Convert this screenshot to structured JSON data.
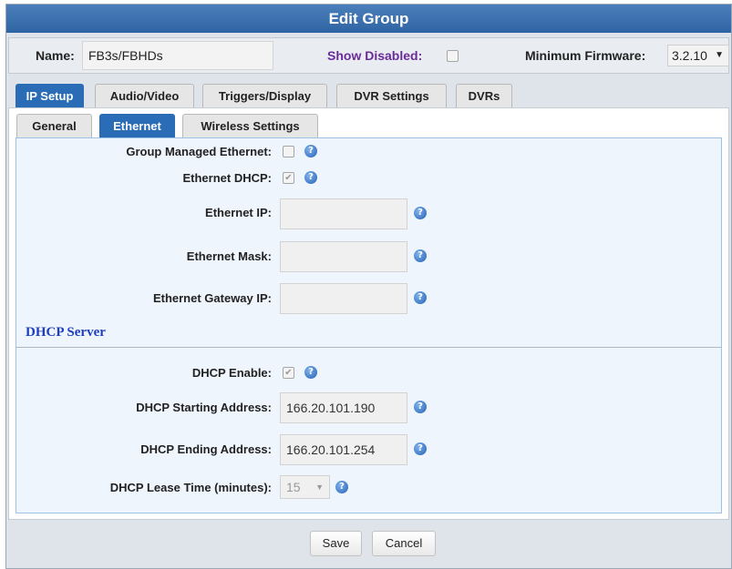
{
  "window": {
    "title": "Edit Group"
  },
  "topbar": {
    "name_label": "Name:",
    "name_value": "FB3s/FBHDs",
    "show_disabled_label": "Show Disabled:",
    "show_disabled_checked": false,
    "firmware_label": "Minimum Firmware:",
    "firmware_value": "3.2.10",
    "firmware_arrow": "▼"
  },
  "main_tabs": [
    {
      "label": "IP Setup",
      "active": true
    },
    {
      "label": "Audio/Video",
      "active": false
    },
    {
      "label": "Triggers/Display",
      "active": false
    },
    {
      "label": "DVR Settings",
      "active": false
    },
    {
      "label": "DVRs",
      "active": false
    }
  ],
  "sub_tabs": [
    {
      "label": "General",
      "active": false
    },
    {
      "label": "Ethernet",
      "active": true
    },
    {
      "label": "Wireless Settings",
      "active": false
    }
  ],
  "ethernet": {
    "group_managed_label": "Group Managed Ethernet:",
    "group_managed_checked": false,
    "dhcp_label": "Ethernet DHCP:",
    "dhcp_checked": true,
    "ip_label": "Ethernet IP:",
    "ip_value": "",
    "mask_label": "Ethernet Mask:",
    "mask_value": "",
    "gateway_label": "Ethernet Gateway IP:",
    "gateway_value": ""
  },
  "dhcp_server": {
    "section_title": "DHCP Server",
    "enable_label": "DHCP Enable:",
    "enable_checked": true,
    "start_label": "DHCP Starting Address:",
    "start_value": "166.20.101.190",
    "end_label": "DHCP Ending Address:",
    "end_value": "166.20.101.254",
    "lease_label": "DHCP Lease Time (minutes):",
    "lease_value": "15",
    "lease_arrow": "▼"
  },
  "icons": {
    "help": "?",
    "check": "✔"
  },
  "buttons": {
    "save": "Save",
    "cancel": "Cancel"
  },
  "colors": {
    "accent": "#2a6cb5",
    "title_bar": "#3b6fae",
    "section_title": "#1d3fbf",
    "purple_label": "#6a2b9a"
  }
}
